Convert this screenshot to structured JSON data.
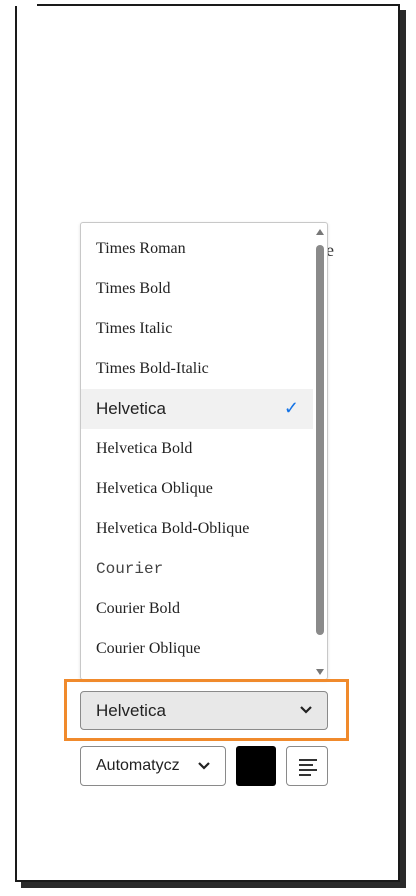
{
  "font_options": [
    {
      "label": "Times Roman",
      "style": "times"
    },
    {
      "label": "Times Bold",
      "style": "times-bold"
    },
    {
      "label": "Times Italic",
      "style": "times-italic"
    },
    {
      "label": "Times Bold-Italic",
      "style": "times-bold-italic"
    },
    {
      "label": "Helvetica",
      "style": "helvetica",
      "selected": true
    },
    {
      "label": "Helvetica Bold",
      "style": "times"
    },
    {
      "label": "Helvetica Oblique",
      "style": "times"
    },
    {
      "label": "Helvetica Bold-Oblique",
      "style": "times"
    },
    {
      "label": "Courier",
      "style": "courier"
    },
    {
      "label": "Courier Bold",
      "style": "times"
    },
    {
      "label": "Courier Oblique",
      "style": "times"
    }
  ],
  "check_mark": "✓",
  "font_select": {
    "value": "Helvetica"
  },
  "size_select": {
    "value": "Automatycz"
  },
  "text_color": "#000000",
  "highlight_color": "#f08a2c",
  "accent_color": "#1473e6",
  "align_icon": "align-left-icon",
  "background_fragment": "e"
}
